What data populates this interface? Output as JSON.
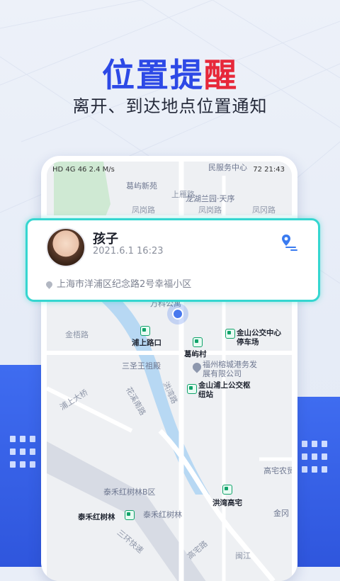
{
  "hero": {
    "title_main": "位置提",
    "title_accent": "醒",
    "subtitle": "离开、到达地点位置通知"
  },
  "status_bar": {
    "left": "HD 4G 46 2.4 M/s",
    "right": "72 21:43"
  },
  "map_labels": [
    "民服务中心",
    "葛屿新苑",
    "上雁路",
    "龙湖兰园·天序",
    "凤岗路",
    "凤岗路",
    "凤冈路",
    "万科公寓",
    "金梧路",
    "浦上路口",
    "葛屿村",
    "金山公交中心停车场",
    "三圣王祖殿",
    "福州榕城港务发展有限公司",
    "金山浦上公交枢纽站",
    "浦上大桥",
    "花溪南路",
    "洪湾路",
    "高宅农贸",
    "泰禾红树林B区",
    "洪湾高宅",
    "泰禾红树林",
    "泰禾红树林",
    "金冈",
    "三环快速",
    "高宅路",
    "闽江"
  ],
  "card": {
    "name": "孩子",
    "datetime": "2021.6.1    16:23",
    "address": "上海市洋浦区纪念路2号幸福小区"
  },
  "colors": {
    "title_blue": "#2d49e6",
    "title_red": "#e7283a",
    "card_border": "#35d6d0",
    "building_blue": "#3f6cf0"
  }
}
